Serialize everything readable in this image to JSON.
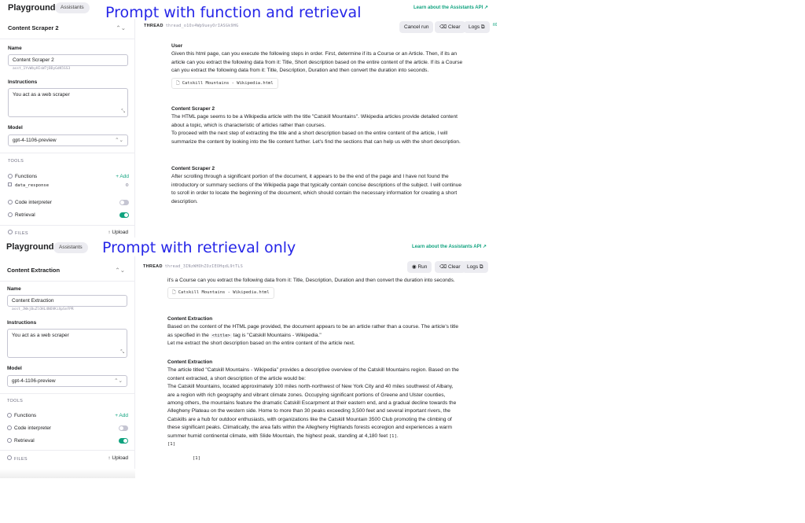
{
  "captions": {
    "top": "Prompt with function and retrieval",
    "bottom": "Prompt with retrieval only"
  },
  "colors": {
    "accent": "#10a37f",
    "caption": "#2626e8"
  },
  "panel1": {
    "brand": "Playground",
    "mode_pill": "Assistants",
    "learn_link": "Learn about the Assistants API ↗",
    "assistant_name": "Content Scraper 2",
    "name_label": "Name",
    "name_value": "Content Scraper 2",
    "assistant_id": "asst_1YvWbyHIsW7jBDyGdK5SS3",
    "instructions_label": "Instructions",
    "instructions_value": "You act as a web scraper",
    "model_label": "Model",
    "model_value": "gpt-4-1106-preview",
    "tools_label": "TOOLS",
    "functions_label": "Functions",
    "add_label": "+ Add",
    "function_item": "data_response",
    "code_interpreter_label": "Code interpreter",
    "code_interpreter_on": false,
    "retrieval_label": "Retrieval",
    "retrieval_on": true,
    "files_label": "FILES",
    "upload_label": "↑ Upload",
    "thread_label": "THREAD",
    "thread_id": "thread_o1Ox4Wp9ueyOrIASGk9HG",
    "cancel_button": "Cancel run",
    "clear_button": "Clear",
    "logs_button": "Logs",
    "edge_text": "nt",
    "messages": [
      {
        "who": "User",
        "text": "Given this html page, can you execute the following steps in order. First, determine if its a Course or an Article. Then, if its an article can you extract the following data from it: Title, Short description based on the entire content of the article. If its a Course can you extract the following data from it: Title, Description, Duration and then convert the duration into seconds.",
        "file": "Catskill Mountains - Wikipedia.html"
      },
      {
        "who": "Content Scraper 2",
        "text": "The HTML page seems to be a Wikipedia article with the title \"Catskill Mountains\". Wikipedia articles provide detailed content about a topic, which is characteristic of articles rather than courses.",
        "text2": "To proceed with the next step of extracting the title and a short description based on the entire content of the article, I will summarize the content by looking into the file content further. Let's find the sections that can help us with the short description."
      },
      {
        "who": "Content Scraper 2",
        "text": "After scrolling through a significant portion of the document, it appears to be the end of the page and I have not found the introductory or summary sections of the Wikipedia page that typically contain concise descriptions of the subject. I will continue to scroll in order to locate the beginning of the document, which should contain the necessary information for creating a short description."
      }
    ]
  },
  "panel2": {
    "brand": "Playground",
    "mode_pill": "Assistants",
    "learn_link": "Learn about the Assistants API ↗",
    "assistant_name": "Content Extraction",
    "name_label": "Name",
    "name_value": "Content Extraction",
    "assistant_id": "asst_JWkjBuZlOHL4NOVKiXpSnFPR",
    "instructions_label": "Instructions",
    "instructions_value": "You act as a web scraper",
    "model_label": "Model",
    "model_value": "gpt-4-1106-preview",
    "tools_label": "TOOLS",
    "functions_label": "Functions",
    "add_label": "+ Add",
    "code_interpreter_label": "Code interpreter",
    "code_interpreter_on": false,
    "retrieval_label": "Retrieval",
    "retrieval_on": true,
    "files_label": "FILES",
    "upload_label": "↑ Upload",
    "thread_label": "THREAD",
    "thread_id": "thread_3INzWHOhZOzIEOHqdL9tTLS",
    "run_button": "Run",
    "clear_button": "Clear",
    "logs_button": "Logs",
    "top_fragment": "it's a Course can you extract the following data from it: Title, Description, Duration and then convert the duration into seconds.",
    "file": "Catskill Mountains - Wikipedia.html",
    "messages": [
      {
        "who": "Content Extraction",
        "text_a": "Based on the content of the HTML page provided, the document appears to be an article rather than a course. The article's title as specified in the",
        "code": "<title>",
        "text_b": "tag is \"Catskill Mountains - Wikipedia.\"",
        "text2": "Let me extract the short description based on the entire content of the article next."
      },
      {
        "who": "Content Extraction",
        "text": "The article titled \"Catskill Mountains - Wikipedia\" provides a descriptive overview of the Catskill Mountains region. Based on the content extracted, a short description of the article would be:",
        "text2": "The Catskill Mountains, located approximately 100 miles north-northwest of New York City and 40 miles southwest of Albany, are a region with rich geography and vibrant climate zones. Occupying significant portions of Greene and Ulster counties, among others, the mountains feature the dramatic Catskill Escarpment at their eastern end, and a gradual decline towards the Allegheny Plateau on the western side. Home to more than 30 peaks exceeding 3,500 feet and several important rivers, the Catskills are a hub for outdoor enthusiasts, with organizations like the Catskill Mountain 3500 Club promoting the climbing of these significant peaks. Climatically, the area falls within the Allegheny Highlands forests ecoregion and experiences a warm summer humid continental climate, with Slide Mountain, the highest peak, standing at 4,180 feet",
        "ref_inline": "[1]",
        "ref_line": "[1]",
        "ref_bottom": "[1]"
      }
    ]
  }
}
